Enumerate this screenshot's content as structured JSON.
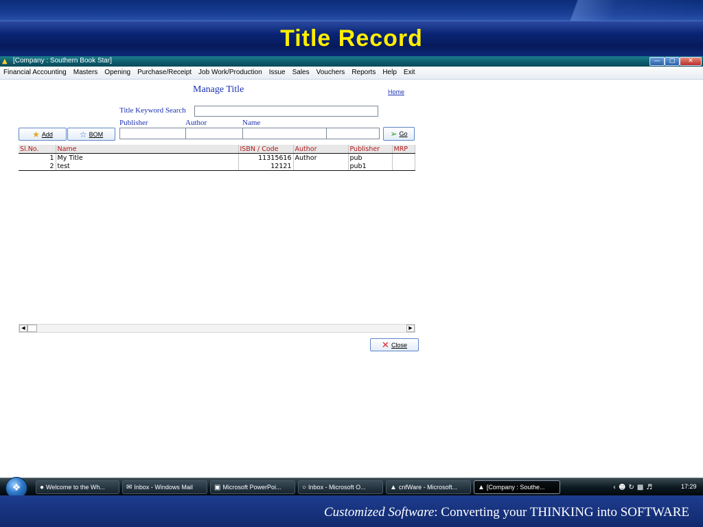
{
  "slide": {
    "title": "Title Record",
    "footer_emphasis": "Customized Software",
    "footer_rest": ":   Converting your THINKING into SOFTWARE"
  },
  "window": {
    "title": "[Company : Southern Book Star]"
  },
  "menu": {
    "items": [
      "Financial Accounting",
      "Masters",
      "Opening",
      "Purchase/Receipt",
      "Job Work/Production",
      "Issue",
      "Sales",
      "Vouchers",
      "Reports",
      "Help",
      "Exit"
    ]
  },
  "page": {
    "heading": "Manage Title",
    "home_link": "Home",
    "keyword_label": "Title Keyword Search",
    "keyword_value": "",
    "filters": {
      "publisher_label": "Publisher",
      "author_label": "Author",
      "name_label": "Name"
    },
    "buttons": {
      "add": "Add",
      "bom": "BOM",
      "go": "Go",
      "close": "Close"
    }
  },
  "table": {
    "headers": [
      "Sl.No.",
      "Name",
      "ISBN / Code",
      "Author",
      "Publisher",
      "MRP"
    ],
    "rows": [
      [
        "1",
        "My Title",
        "11315616",
        "Author",
        "pub",
        ""
      ],
      [
        "2",
        "test",
        "12121",
        "",
        "pub1",
        ""
      ]
    ]
  },
  "taskbar": {
    "items": [
      {
        "label": "Welcome to the Wh...",
        "icon": "browser-icon"
      },
      {
        "label": "Inbox - Windows Mail",
        "icon": "mail-icon"
      },
      {
        "label": "Microsoft PowerPoi...",
        "icon": "powerpoint-icon"
      },
      {
        "label": "Inbox - Microsoft O...",
        "icon": "outlook-icon"
      },
      {
        "label": "cnfWare - Microsoft...",
        "icon": "app-icon"
      },
      {
        "label": "[Company : Southe...",
        "icon": "app-icon"
      }
    ],
    "clock": "17:29"
  },
  "colors": {
    "slide_title": "#ffee00",
    "header_text": "#b01818",
    "form_label": "#1a2fb0"
  }
}
